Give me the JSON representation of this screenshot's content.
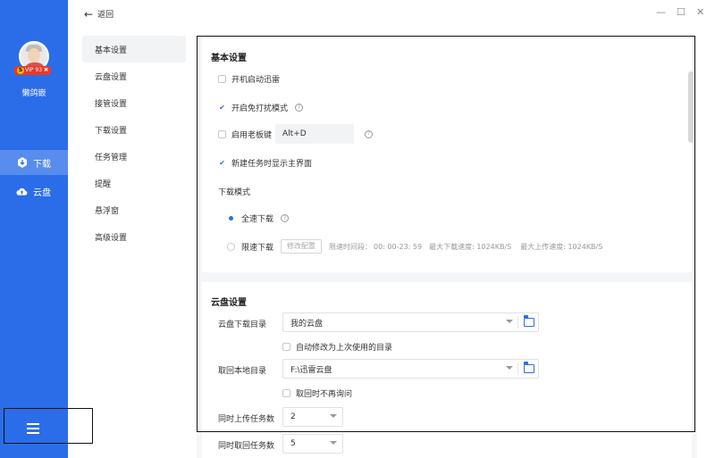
{
  "sidebar": {
    "username": "懒鸽嵌",
    "vip_label": "VIP 93 ✖",
    "vip_icon_letter": "S",
    "items": [
      {
        "label": "下载",
        "icon": "download-icon",
        "active": true
      },
      {
        "label": "云盘",
        "icon": "cloud-icon",
        "active": false
      }
    ],
    "menu_icon": "hamburger-menu-icon"
  },
  "topbar": {
    "back_label": "返回",
    "minimize": "—",
    "maximize": "☐",
    "close": "✕"
  },
  "settings_menu": [
    {
      "label": "基本设置",
      "active": true
    },
    {
      "label": "云盘设置"
    },
    {
      "label": "接管设置"
    },
    {
      "label": "下载设置"
    },
    {
      "label": "任务管理"
    },
    {
      "label": "提醒"
    },
    {
      "label": "悬浮窗"
    },
    {
      "label": "高级设置"
    }
  ],
  "basic": {
    "title": "基本设置",
    "startup": {
      "label": "开机启动迅雷",
      "checked": false
    },
    "dnd": {
      "label": "开启免打扰模式",
      "checked": true
    },
    "boss_key": {
      "label": "启用老板键",
      "checked": false,
      "value": "Alt+D"
    },
    "show_main": {
      "label": "新建任务时显示主界面",
      "checked": true
    },
    "download_mode_label": "下载模式",
    "full_speed": {
      "label": "全速下载",
      "selected": true
    },
    "limited": {
      "label": "限速下载",
      "selected": false,
      "button": "修改配置",
      "period_label": "限速时间段：",
      "period": "00: 00-23: 59",
      "max_down": "最大下载速度: 1024KB/S",
      "max_up": "最大上传速度: 1024KB/S"
    }
  },
  "cloud": {
    "title": "云盘设置",
    "download_dir_label": "云盘下载目录",
    "download_dir_value": "我的云盘",
    "auto_change_label": "自动修改为上次使用的目录",
    "retrieve_dir_label": "取回本地目录",
    "retrieve_dir_value": "F:\\迅雷云盘",
    "no_ask_label": "取回时不再询问",
    "upload_tasks_label": "同时上传任务数",
    "upload_tasks_value": "2",
    "retrieve_tasks_label": "同时取回任务数",
    "retrieve_tasks_value": "5"
  }
}
